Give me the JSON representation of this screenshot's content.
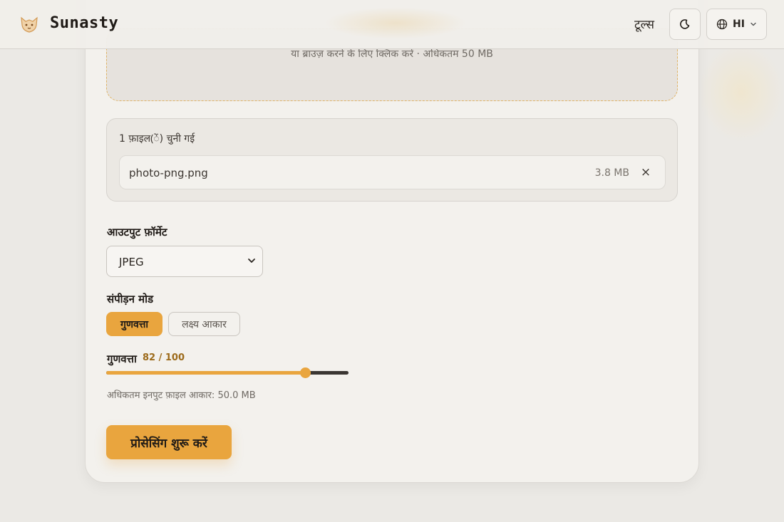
{
  "header": {
    "brand": "Sunasty",
    "nav_tools": "टूल्स",
    "language": "HI"
  },
  "dropzone": {
    "hint": "या ब्राउज़ करने के लिए क्लिक करें · अधिकतम 50 MB"
  },
  "files": {
    "count_label": "1 फ़ाइल(ें) चुनी गई",
    "items": [
      {
        "name": "photo-png.png",
        "size": "3.8 MB",
        "remove": "×"
      }
    ]
  },
  "output_format": {
    "label": "आउटपुट फ़ॉर्मेट",
    "selected": "JPEG"
  },
  "compression": {
    "label": "संपीड़न मोड",
    "modes": [
      "गुणवत्ता",
      "लक्ष्य आकार"
    ],
    "active_mode": "गुणवत्ता"
  },
  "quality": {
    "label": "गुणवत्ता",
    "value_text": "82 / 100",
    "value": 82,
    "max": 100
  },
  "max_input": "अधिकतम इनपुट फ़ाइल आकार: 50.0 MB",
  "start_button": "प्रोसेसिंग शुरू करें",
  "colors": {
    "accent": "#e9a53e",
    "background": "#ebe9e5",
    "card": "#f3f1ed"
  },
  "icons": {
    "logo": "fox-logo-icon",
    "theme": "moon-icon",
    "language": "globe-icon",
    "dropdown": "chevron-down-icon",
    "remove": "close-icon"
  }
}
